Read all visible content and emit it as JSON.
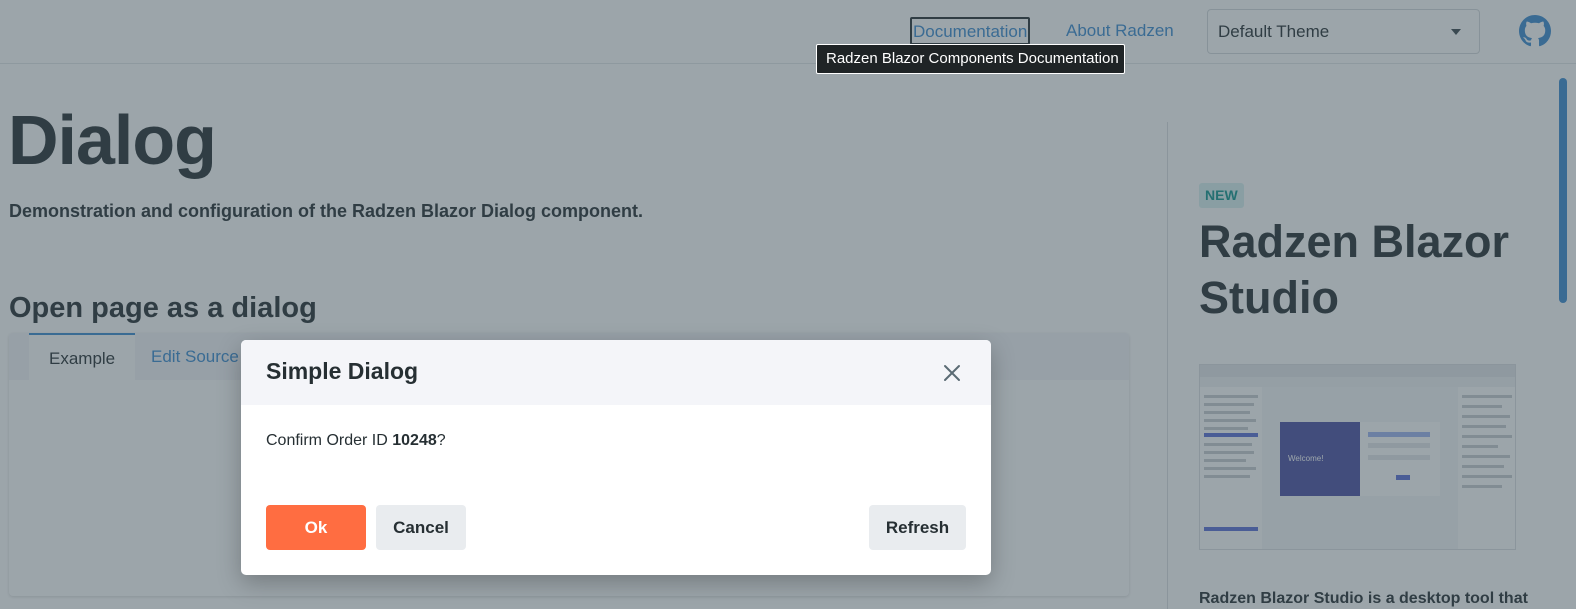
{
  "nav": {
    "documentation": "Documentation",
    "about": "About Radzen",
    "theme": "Default Theme",
    "tooltip": "Radzen Blazor Components Documentation"
  },
  "main": {
    "title": "Dialog",
    "subtitle": "Demonstration and configuration of the Radzen Blazor Dialog component.",
    "section_title": "Open page as a dialog",
    "tabs": [
      {
        "label": "Example"
      },
      {
        "label": "Edit Source"
      }
    ]
  },
  "sidebar": {
    "badge": "NEW",
    "promo_title": "Radzen Blazor Studio",
    "promo_text": "Radzen Blazor Studio is a desktop tool that"
  },
  "dialog": {
    "title": "Simple Dialog",
    "body_prefix": "Confirm Order ID ",
    "order_id": "10248",
    "body_suffix": "?",
    "ok": "Ok",
    "cancel": "Cancel",
    "refresh": "Refresh"
  },
  "colors": {
    "accent": "#3b8bd1",
    "primary_button": "#ff6d41",
    "badge_text": "#11958f"
  },
  "icons": {
    "github": "github-icon",
    "close": "close-icon",
    "dropdown": "chevron-down-icon"
  }
}
